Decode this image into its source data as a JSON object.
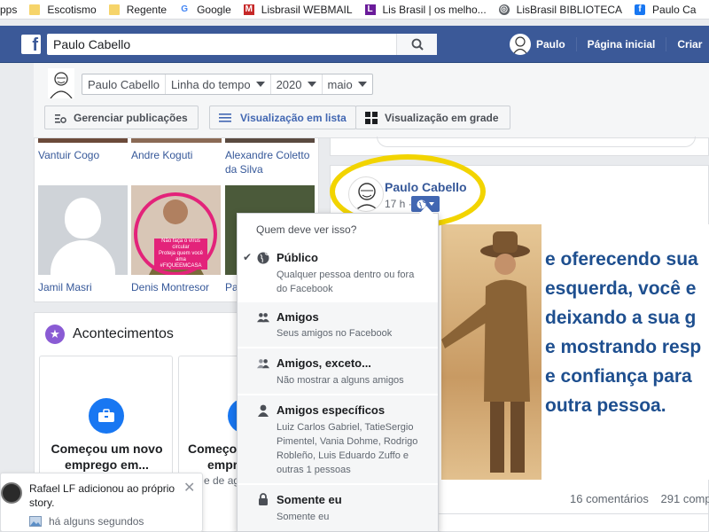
{
  "bookmarks": [
    {
      "label": "pps",
      "icon": "apps-icon"
    },
    {
      "label": "Escotismo",
      "icon": "folder-icon"
    },
    {
      "label": "Regente",
      "icon": "folder-icon"
    },
    {
      "label": "Google",
      "icon": "google-icon"
    },
    {
      "label": "Lisbrasil WEBMAIL",
      "icon": "mail-icon"
    },
    {
      "label": "Lis Brasil | os melho...",
      "icon": "lis-icon"
    },
    {
      "label": "LisBrasil BIBLIOTECA",
      "icon": "globe-icon"
    },
    {
      "label": "Paulo Ca",
      "icon": "facebook-icon"
    }
  ],
  "topbar": {
    "search_value": "Paulo Cabello",
    "user_name": "Paulo",
    "home_label": "Página inicial",
    "create_label": "Criar"
  },
  "timeline": {
    "profile_name": "Paulo Cabello",
    "section": "Linha do tempo",
    "year": "2020",
    "month": "maio",
    "manage_label": "Gerenciar publicações",
    "list_view_label": "Visualização em lista",
    "grid_view_label": "Visualização em grade"
  },
  "friends": {
    "row1": [
      "Vantuir Cogo",
      "Andre Koguti",
      "Alexandre Coletto",
      "da Silva"
    ],
    "row2": [
      "Jamil Masri",
      "Denis Montresor",
      "Pa"
    ],
    "denis_caption_1": "Não faça o vírus circular",
    "denis_caption_2": "Proteja quem você ama",
    "denis_caption_3": "#FIQUEEMCASA"
  },
  "events": {
    "title": "Acontecimentos",
    "card1_line1": "Começou um novo",
    "card1_line2": "emprego em...",
    "card2_line1": "Começo",
    "card2_line2": "empr",
    "card2_line3": "e de ago"
  },
  "post": {
    "author": "Paulo Cabello",
    "time": "17 h",
    "quote_lines": [
      "e oferecendo sua",
      "esquerda, você e",
      "deixando a sua g",
      "e mostrando resp",
      "e confiança para",
      "outra pessoa."
    ],
    "comments": "16 comentários",
    "shares": "291 compa"
  },
  "privacy_menu": {
    "title": "Quem deve ver isso?",
    "options": [
      {
        "label": "Público",
        "desc": "Qualquer pessoa dentro ou fora do Facebook",
        "icon": "globe-icon",
        "selected": true
      },
      {
        "label": "Amigos",
        "desc": "Seus amigos no Facebook",
        "icon": "friends-icon"
      },
      {
        "label": "Amigos, exceto...",
        "desc": "Não mostrar a alguns amigos",
        "icon": "friends-except-icon"
      },
      {
        "label": "Amigos específicos",
        "desc": "Luiz Carlos Gabriel, TatieSergio Pimentel, Vania Dohme, Rodrigo Robleño, Luis Eduardo Zuffo e outras 1 pessoas",
        "icon": "person-icon"
      },
      {
        "label": "Somente eu",
        "desc": "Somente eu",
        "icon": "lock-icon"
      }
    ]
  },
  "toast": {
    "text": "Rafael LF adicionou ao próprio story.",
    "time": "há alguns segundos"
  },
  "colors": {
    "fb_blue": "#3b5998",
    "link_blue": "#365899",
    "highlight": "#f2d400"
  }
}
